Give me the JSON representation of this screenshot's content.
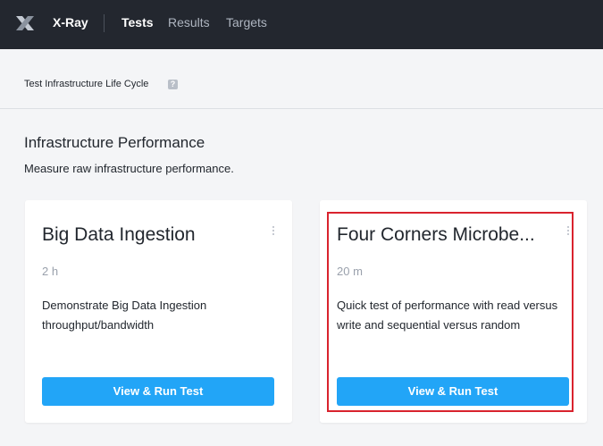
{
  "header": {
    "app_name": "X-Ray",
    "tabs": [
      {
        "label": "Tests",
        "active": true
      },
      {
        "label": "Results",
        "active": false
      },
      {
        "label": "Targets",
        "active": false
      }
    ],
    "background_color": "#23272f"
  },
  "breadcrumb": {
    "label": "Test Infrastructure Life Cycle",
    "help_icon": "?"
  },
  "section": {
    "title": "Infrastructure Performance",
    "description": "Measure raw infrastructure performance."
  },
  "cards": [
    {
      "title": "Big Data Ingestion",
      "duration": "2 h",
      "description": "Demonstrate Big Data Ingestion throughput/bandwidth",
      "button_label": "View & Run Test",
      "highlighted": false
    },
    {
      "title": "Four Corners Microbe...",
      "duration": "20 m",
      "description": "Quick test of performance with read versus write and sequential versus random",
      "button_label": "View & Run Test",
      "highlighted": true
    }
  ],
  "colors": {
    "accent": "#22a5f7",
    "highlight": "#d9232e"
  }
}
